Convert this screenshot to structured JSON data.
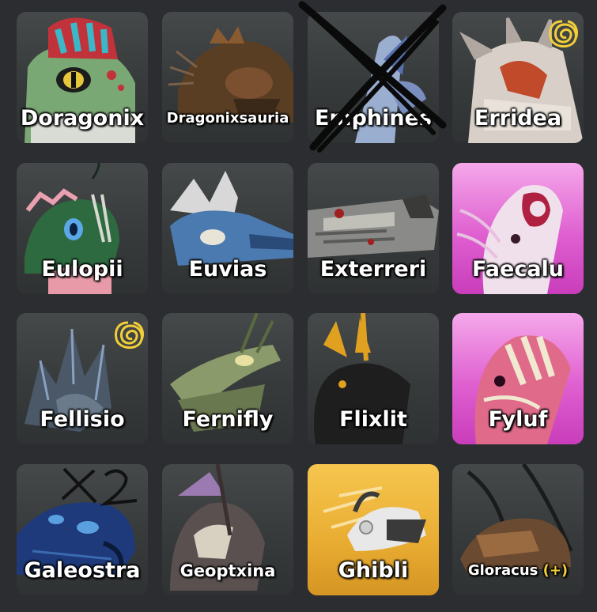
{
  "cards": [
    {
      "name": "Doragonix",
      "label_size": "normal",
      "bg": "dark",
      "badge": false,
      "main_color": "#7aa874",
      "accent_color": "#c2323a"
    },
    {
      "name": "Dragonixsauria",
      "label_size": "small",
      "bg": "dark",
      "badge": false,
      "main_color": "#6a4a2c",
      "accent_color": "#9a7040"
    },
    {
      "name": "Emphines",
      "label_size": "normal",
      "bg": "dark",
      "badge": false,
      "crossed_out": true,
      "main_color": "#9aaed0",
      "accent_color": "#5870b0"
    },
    {
      "name": "Erridea",
      "label_size": "normal",
      "bg": "dark",
      "badge": true,
      "main_color": "#d8d0c8",
      "accent_color": "#c04a2a"
    },
    {
      "name": "Eulopii",
      "label_size": "normal",
      "bg": "dark",
      "badge": false,
      "main_color": "#2e6a40",
      "accent_color": "#e9a0b0"
    },
    {
      "name": "Euvias",
      "label_size": "normal",
      "bg": "dark",
      "badge": false,
      "main_color": "#4a7ab0",
      "accent_color": "#e0e0e0"
    },
    {
      "name": "Exterreri",
      "label_size": "normal",
      "bg": "dark",
      "badge": false,
      "main_color": "#8a8a88",
      "accent_color": "#a02020"
    },
    {
      "name": "Faecalu",
      "label_size": "normal",
      "bg": "pink",
      "badge": false,
      "main_color": "#f0e0ec",
      "accent_color": "#b02040"
    },
    {
      "name": "Fellisio",
      "label_size": "normal",
      "bg": "dark",
      "badge": true,
      "main_color": "#4a5868",
      "accent_color": "#8aa0c0"
    },
    {
      "name": "Fernifly",
      "label_size": "normal",
      "bg": "dark",
      "badge": false,
      "main_color": "#8a9a6a",
      "accent_color": "#6a7850"
    },
    {
      "name": "Flixlit",
      "label_size": "normal",
      "bg": "dark",
      "badge": false,
      "main_color": "#1e1e1e",
      "accent_color": "#e0a020"
    },
    {
      "name": "Fyluf",
      "label_size": "normal",
      "bg": "pink",
      "badge": false,
      "main_color": "#e06a8a",
      "accent_color": "#f0e8d0"
    },
    {
      "name": "Galeostra",
      "label_size": "normal",
      "bg": "dark",
      "badge": false,
      "scribble": "X2",
      "main_color": "#1e3a7a",
      "accent_color": "#5aa0e0"
    },
    {
      "name": "Geoptxina",
      "label_size": "med",
      "bg": "dark",
      "badge": false,
      "main_color": "#5a5050",
      "accent_color": "#9a7ab0"
    },
    {
      "name": "Ghibli",
      "label_size": "normal",
      "bg": "gold",
      "badge": false,
      "main_color": "#e8e8e8",
      "accent_color": "#3a3a3a"
    },
    {
      "name": "Gloracus",
      "suffix": " (+)",
      "label_size": "small",
      "bg": "dark",
      "badge": false,
      "main_color": "#6a4a30",
      "accent_color": "#9a6a40"
    }
  ],
  "colors": {
    "background": "#2b2d31",
    "badge": "#f2cf37",
    "pink_card": "#df5fd0",
    "gold_card": "#e9ac32"
  }
}
